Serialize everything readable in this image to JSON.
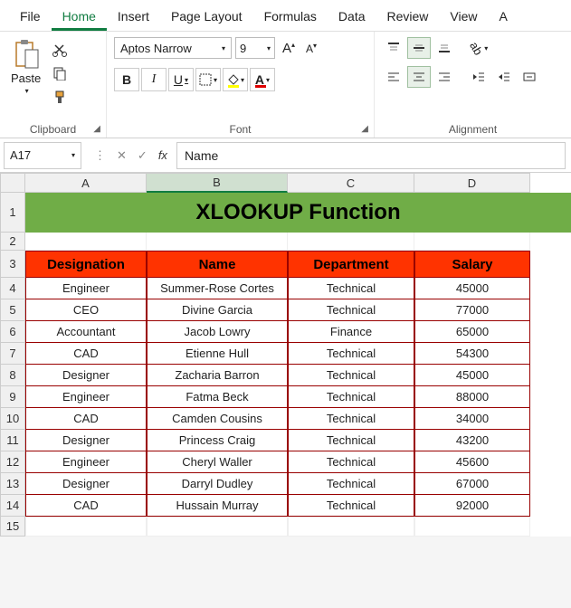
{
  "tabs": [
    "File",
    "Home",
    "Insert",
    "Page Layout",
    "Formulas",
    "Data",
    "Review",
    "View",
    "A"
  ],
  "active_tab": 1,
  "ribbon": {
    "clipboard": {
      "paste": "Paste",
      "label": "Clipboard"
    },
    "font": {
      "name": "Aptos Narrow",
      "size": "9",
      "increase": "A",
      "decrease": "A",
      "bold": "B",
      "italic": "I",
      "underline": "U",
      "label": "Font"
    },
    "alignment": {
      "label": "Alignment"
    }
  },
  "namebox": "A17",
  "formula": "Name",
  "columns": [
    "A",
    "B",
    "C",
    "D"
  ],
  "title": "XLOOKUP Function",
  "headers": [
    "Designation",
    "Name",
    "Department",
    "Salary"
  ],
  "rows": [
    [
      "Engineer",
      "Summer-Rose Cortes",
      "Technical",
      "45000"
    ],
    [
      "CEO",
      "Divine Garcia",
      "Technical",
      "77000"
    ],
    [
      "Accountant",
      "Jacob Lowry",
      "Finance",
      "65000"
    ],
    [
      "CAD",
      "Etienne Hull",
      "Technical",
      "54300"
    ],
    [
      "Designer",
      "Zacharia Barron",
      "Technical",
      "45000"
    ],
    [
      "Engineer",
      "Fatma Beck",
      "Technical",
      "88000"
    ],
    [
      "CAD",
      "Camden Cousins",
      "Technical",
      "34000"
    ],
    [
      "Designer",
      "Princess Craig",
      "Technical",
      "43200"
    ],
    [
      "Engineer",
      "Cheryl Waller",
      "Technical",
      "45600"
    ],
    [
      "Designer",
      "Darryl Dudley",
      "Technical",
      "67000"
    ],
    [
      "CAD",
      "Hussain Murray",
      "Technical",
      "92000"
    ]
  ],
  "row_numbers": [
    "1",
    "2",
    "3",
    "4",
    "5",
    "6",
    "7",
    "8",
    "9",
    "10",
    "11",
    "12",
    "13",
    "14",
    "15"
  ]
}
